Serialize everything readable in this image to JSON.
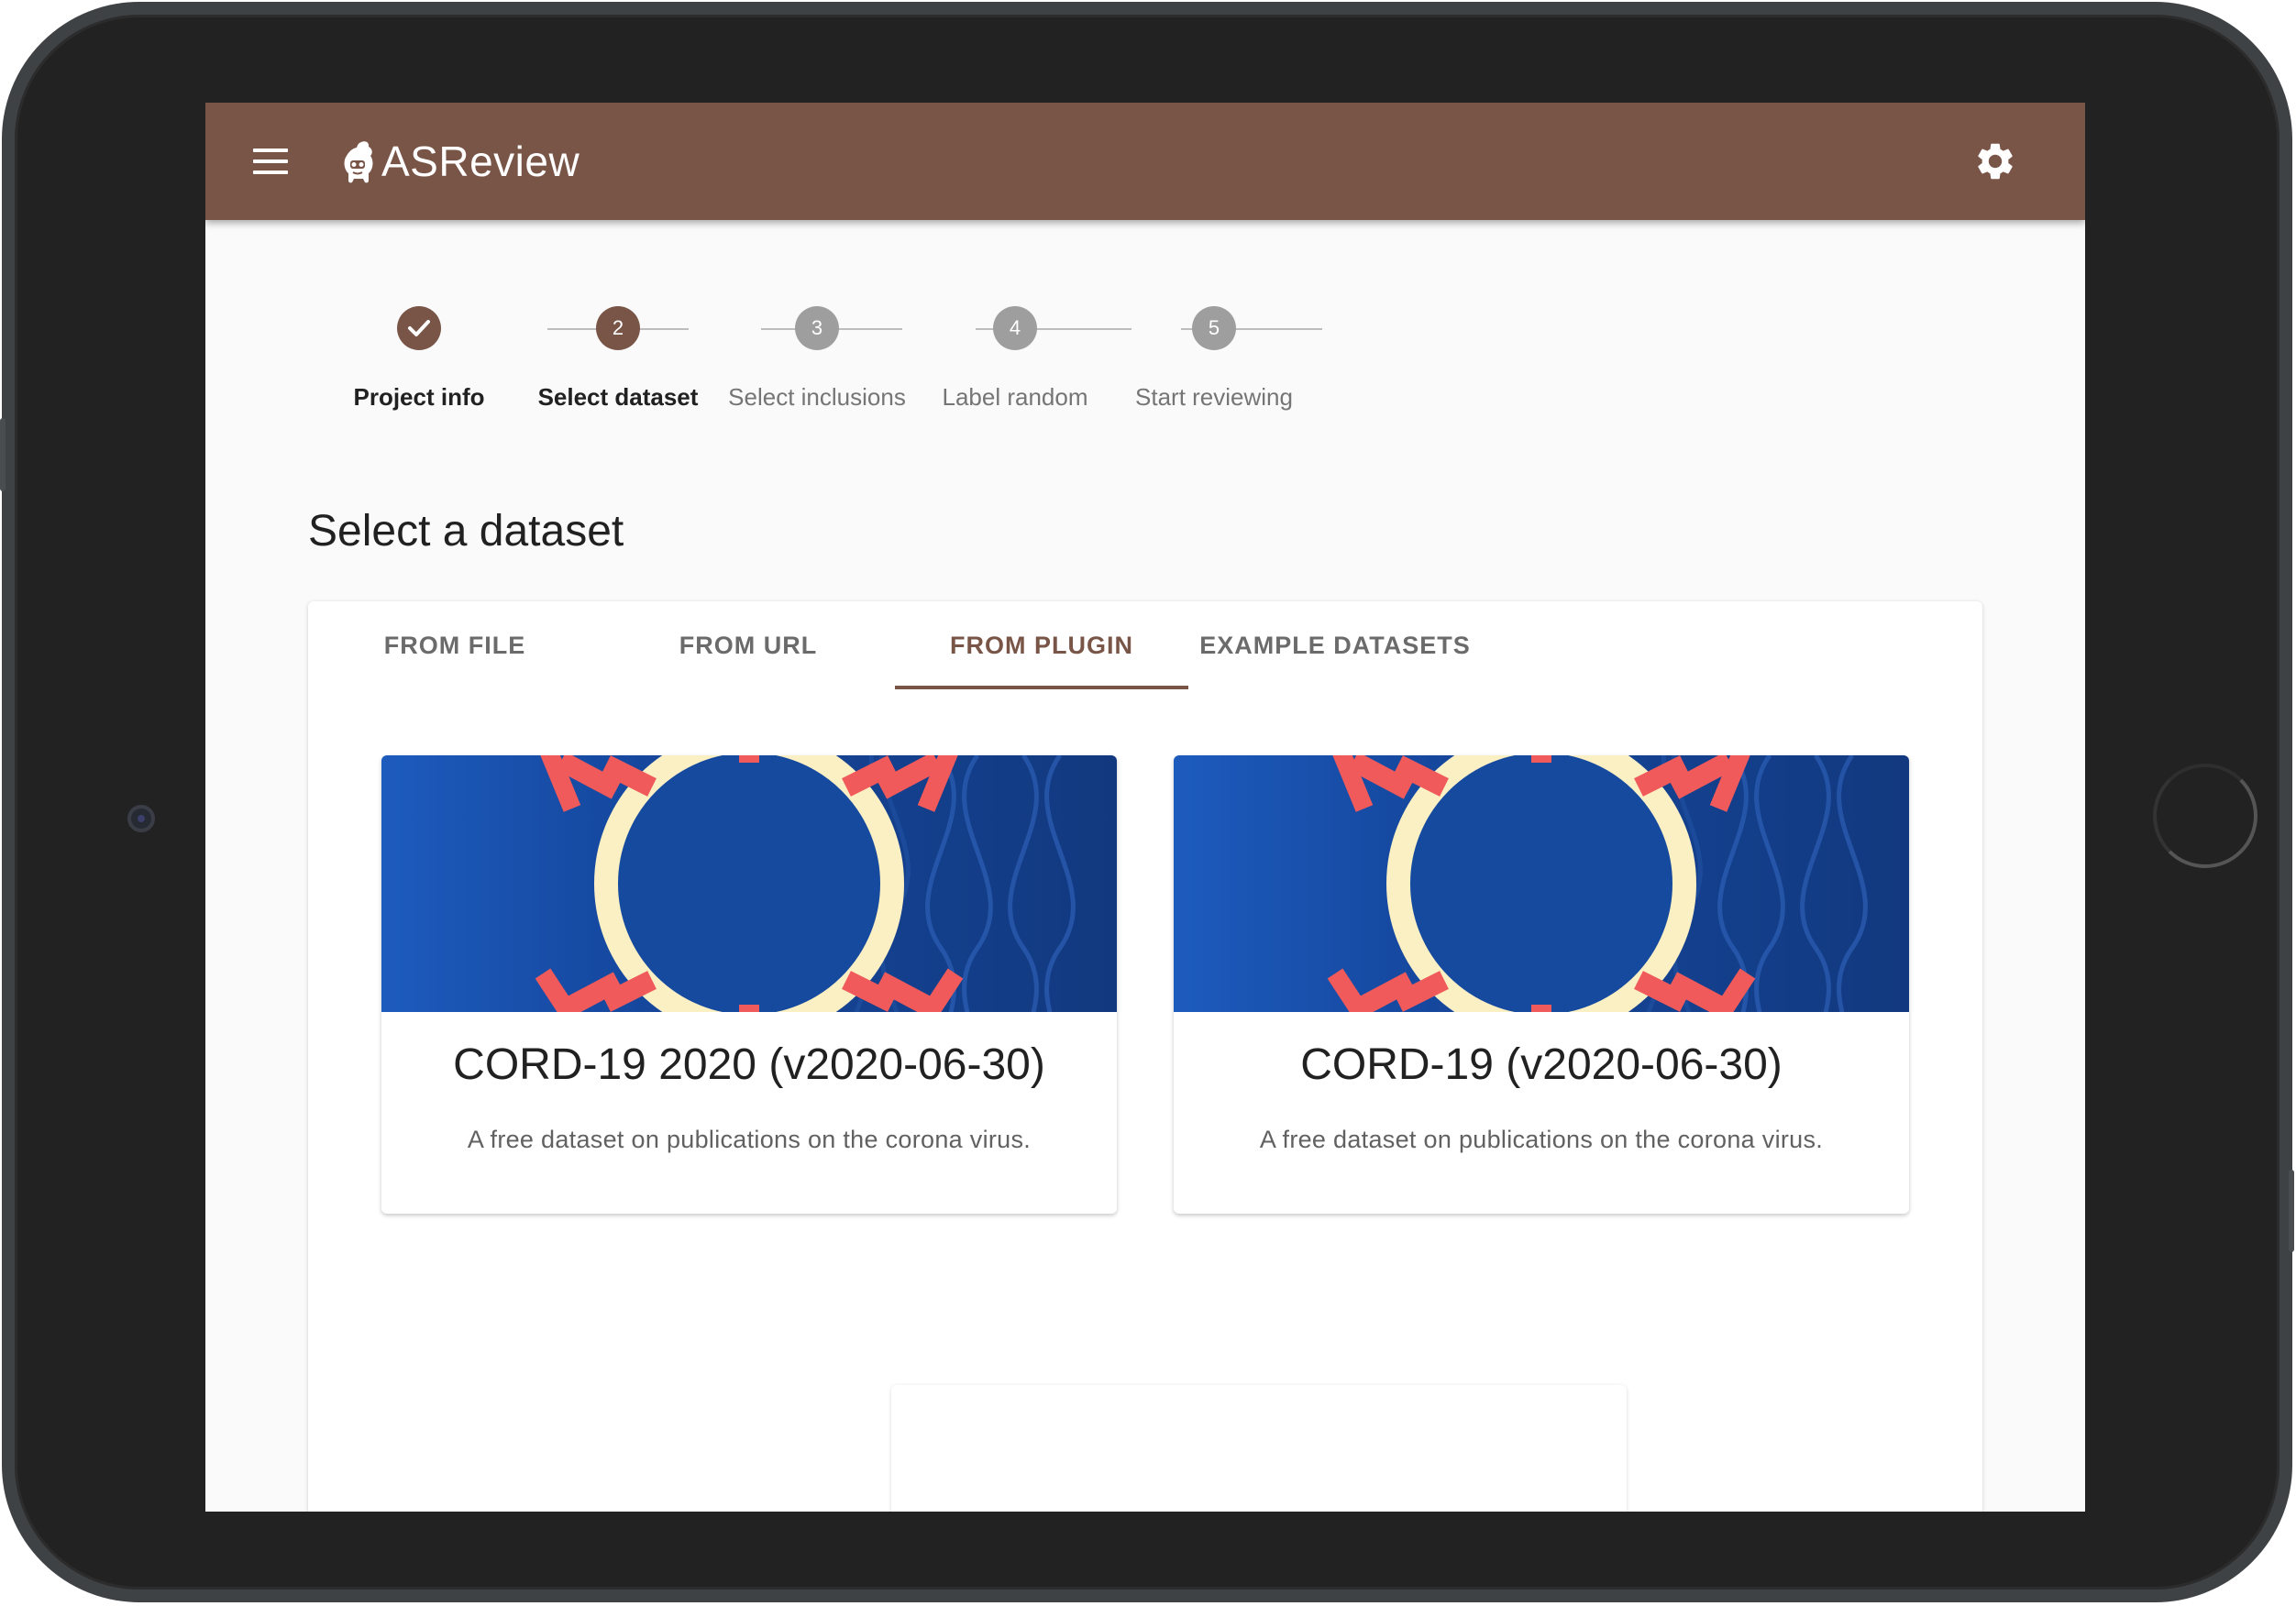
{
  "app": {
    "title": "ASReview",
    "colors": {
      "primary": "#795548",
      "inactive_step": "#9e9e9e",
      "background": "#fafafa"
    },
    "icons": {
      "menu": "menu-icon",
      "logo": "asreview-logo-icon",
      "settings": "gear-icon"
    }
  },
  "stepper": {
    "steps": [
      {
        "number": "",
        "label": "Project info",
        "state": "completed"
      },
      {
        "number": "2",
        "label": "Select dataset",
        "state": "active"
      },
      {
        "number": "3",
        "label": "Select inclusions",
        "state": "inactive"
      },
      {
        "number": "4",
        "label": "Label random",
        "state": "inactive"
      },
      {
        "number": "5",
        "label": "Start reviewing",
        "state": "inactive"
      }
    ]
  },
  "main": {
    "title": "Select a dataset",
    "tabs": [
      {
        "label": "FROM FILE",
        "selected": false
      },
      {
        "label": "FROM URL",
        "selected": false
      },
      {
        "label": "FROM PLUGIN",
        "selected": true
      },
      {
        "label": "EXAMPLE DATASETS",
        "selected": false
      }
    ],
    "datasets": [
      {
        "title": "CORD-19 2020 (v2020-06-30)",
        "description": "A free dataset on publications on the corona virus.",
        "image": "coronavirus-illustration"
      },
      {
        "title": "CORD-19 (v2020-06-30)",
        "description": "A free dataset on publications on the corona virus.",
        "image": "coronavirus-illustration"
      }
    ]
  }
}
